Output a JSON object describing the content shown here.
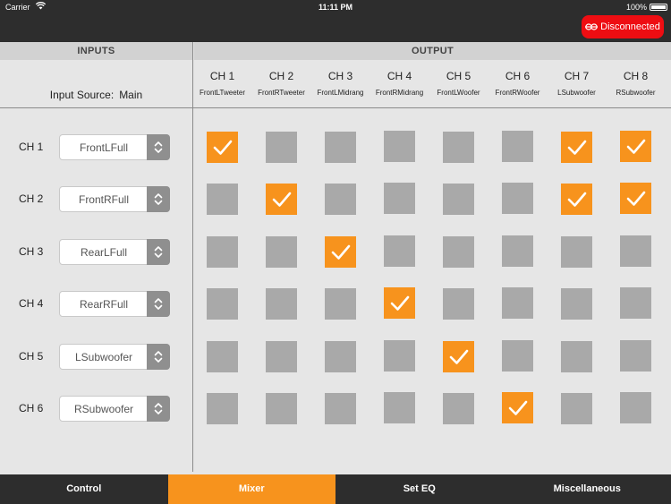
{
  "status": {
    "carrier": "Carrier",
    "time": "11:11 PM",
    "battery": "100%"
  },
  "connection": {
    "label": "Disconnected",
    "color": "#ee0d12"
  },
  "headers": {
    "inputs": "INPUTS",
    "output": "OUTPUT"
  },
  "input_source": {
    "label": "Input Source:",
    "value": "Main"
  },
  "outputs": [
    {
      "ch": "CH 1",
      "name": "FrontLTweeter"
    },
    {
      "ch": "CH 2",
      "name": "FrontRTweeter"
    },
    {
      "ch": "CH 3",
      "name": "FrontLMidrang"
    },
    {
      "ch": "CH 4",
      "name": "FrontRMidrang"
    },
    {
      "ch": "CH 5",
      "name": "FrontLWoofer"
    },
    {
      "ch": "CH 6",
      "name": "FrontRWoofer"
    },
    {
      "ch": "CH 7",
      "name": "LSubwoofer"
    },
    {
      "ch": "CH 8",
      "name": "RSubwoofer"
    }
  ],
  "inputs": [
    {
      "ch": "CH 1",
      "source": "FrontLFull",
      "routes": [
        true,
        false,
        false,
        false,
        false,
        false,
        true,
        true
      ]
    },
    {
      "ch": "CH 2",
      "source": "FrontRFull",
      "routes": [
        false,
        true,
        false,
        false,
        false,
        false,
        true,
        true
      ]
    },
    {
      "ch": "CH 3",
      "source": "RearLFull",
      "routes": [
        false,
        false,
        true,
        false,
        false,
        false,
        false,
        false
      ]
    },
    {
      "ch": "CH 4",
      "source": "RearRFull",
      "routes": [
        false,
        false,
        false,
        true,
        false,
        false,
        false,
        false
      ]
    },
    {
      "ch": "CH 5",
      "source": "LSubwoofer",
      "routes": [
        false,
        false,
        false,
        false,
        true,
        false,
        false,
        false
      ]
    },
    {
      "ch": "CH 6",
      "source": "RSubwoofer",
      "routes": [
        false,
        false,
        false,
        false,
        false,
        true,
        false,
        false
      ]
    }
  ],
  "tabs": [
    {
      "label": "Control",
      "active": false
    },
    {
      "label": "Mixer",
      "active": true
    },
    {
      "label": "Set EQ",
      "active": false
    },
    {
      "label": "Miscellaneous",
      "active": false
    }
  ],
  "colors": {
    "accent": "#f7931d",
    "cell_off": "#a9a9a9",
    "bar": "#2d2d2d"
  }
}
